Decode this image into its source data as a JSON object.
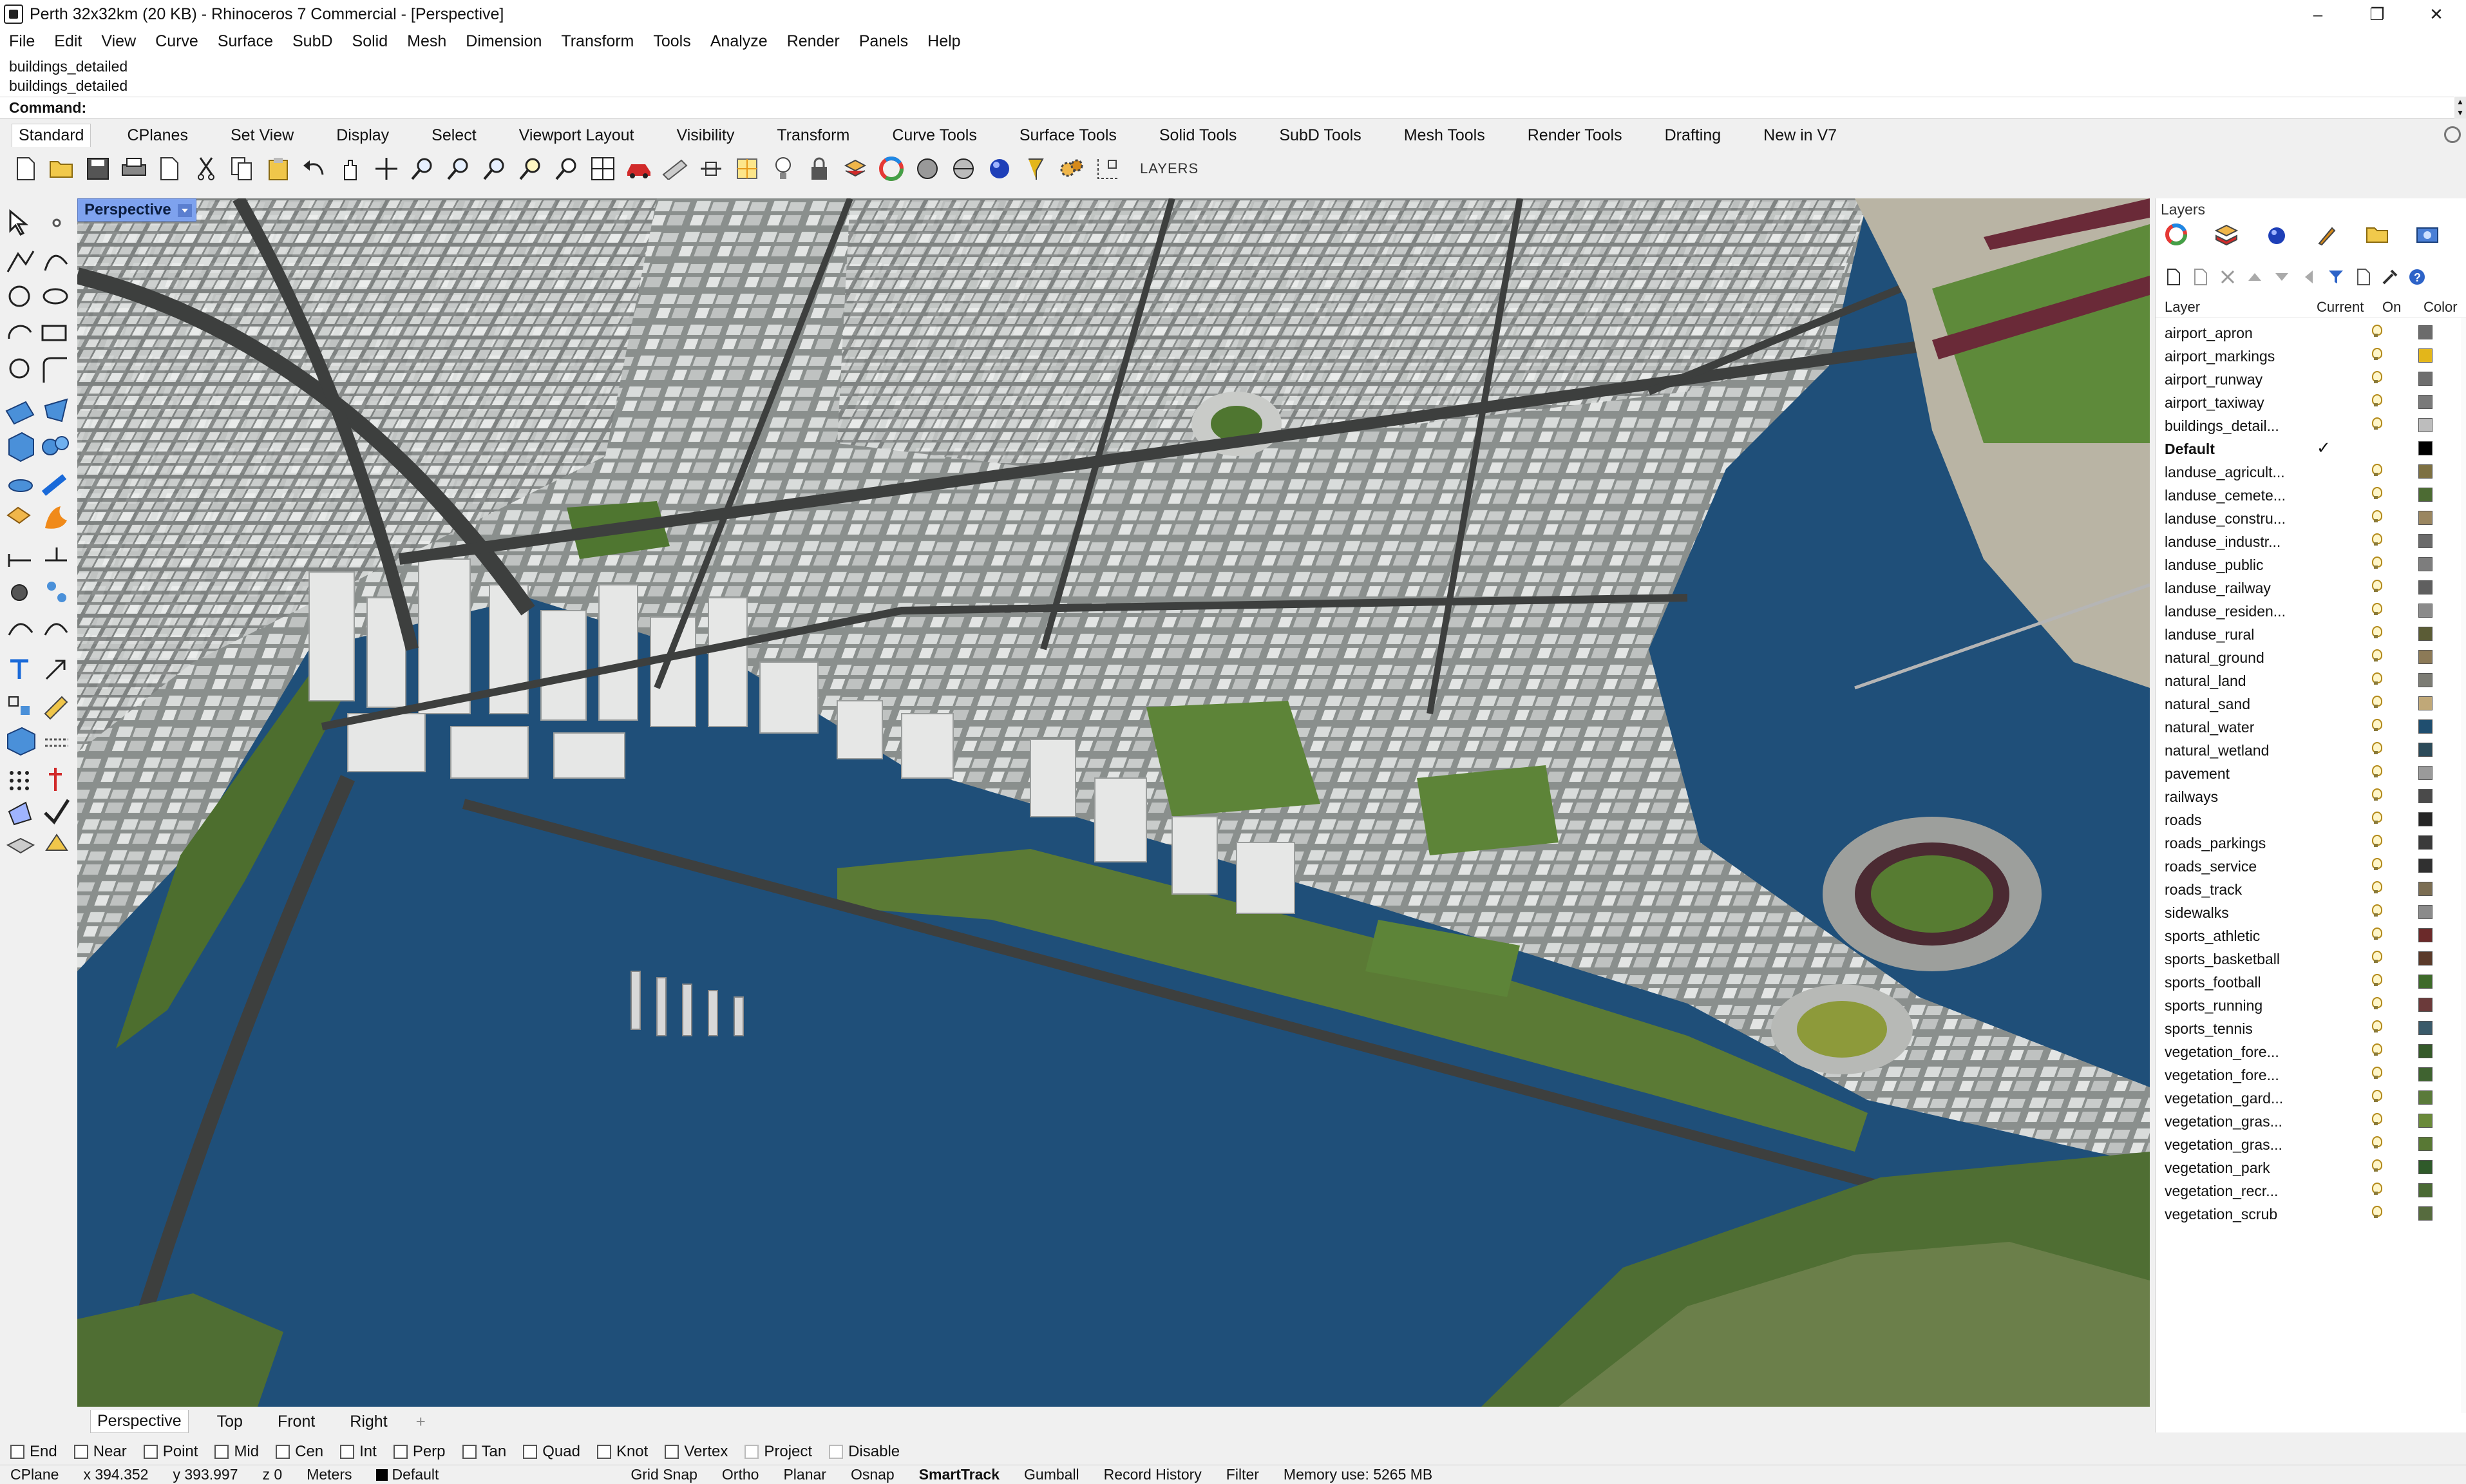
{
  "window": {
    "title": "Perth 32x32km (20 KB) - Rhinoceros 7 Commercial - [Perspective]",
    "minimize": "–",
    "maximize": "❐",
    "close": "✕"
  },
  "menu": [
    "File",
    "Edit",
    "View",
    "Curve",
    "Surface",
    "SubD",
    "Solid",
    "Mesh",
    "Dimension",
    "Transform",
    "Tools",
    "Analyze",
    "Render",
    "Panels",
    "Help"
  ],
  "command_history": [
    "buildings_detailed",
    "buildings_detailed"
  ],
  "command": {
    "label": "Command:",
    "value": ""
  },
  "toolbar_tabs": [
    "Standard",
    "CPlanes",
    "Set View",
    "Display",
    "Select",
    "Viewport Layout",
    "Visibility",
    "Transform",
    "Curve Tools",
    "Surface Tools",
    "Solid Tools",
    "SubD Tools",
    "Mesh Tools",
    "Render Tools",
    "Drafting",
    "New in V7"
  ],
  "toolbar": {
    "icons": [
      "new-icon",
      "open-icon",
      "save-icon",
      "print-icon",
      "import-icon",
      "cut-icon",
      "copy-icon",
      "paste-icon",
      "undo-icon",
      "pan-icon",
      "rotate-view-icon",
      "zoom-icon",
      "zoom-window-icon",
      "zoom-extents-icon",
      "zoom-selected-icon",
      "undo-view-icon",
      "four-viewports-icon",
      "car-icon",
      "ruler-icon",
      "clip-icon",
      "cage-icon",
      "bulb-icon",
      "lock-icon",
      "layer-icon",
      "color-wheel-icon",
      "shade-icon",
      "rendered-icon",
      "sphere-icon",
      "pin-icon",
      "gear-set-icon",
      "grid-snap-icon"
    ],
    "layers_label": "LAYERS"
  },
  "viewport": {
    "label": "Perspective",
    "tabs": [
      "Perspective",
      "Top",
      "Front",
      "Right"
    ],
    "add": "+"
  },
  "osnaps": [
    {
      "label": "End",
      "checked": false
    },
    {
      "label": "Near",
      "checked": false
    },
    {
      "label": "Point",
      "checked": false
    },
    {
      "label": "Mid",
      "checked": false
    },
    {
      "label": "Cen",
      "checked": false
    },
    {
      "label": "Int",
      "checked": false
    },
    {
      "label": "Perp",
      "checked": false
    },
    {
      "label": "Tan",
      "checked": false
    },
    {
      "label": "Quad",
      "checked": false
    },
    {
      "label": "Knot",
      "checked": false
    },
    {
      "label": "Vertex",
      "checked": false
    },
    {
      "label": "Project",
      "checked": false
    },
    {
      "label": "Disable",
      "checked": false
    }
  ],
  "status": {
    "cplane": "CPlane",
    "x": "x 394.352",
    "y": "y 393.997",
    "z": "z 0",
    "units": "Meters",
    "layer": "Default",
    "grid_snap": "Grid Snap",
    "ortho": "Ortho",
    "planar": "Planar",
    "osnap": "Osnap",
    "smarttrack": "SmartTrack",
    "gumball": "Gumball",
    "record_history": "Record History",
    "filter": "Filter",
    "memory": "Memory use: 5265 MB"
  },
  "layers_panel": {
    "title": "Layers",
    "headers": {
      "layer": "Layer",
      "current": "Current",
      "on": "On",
      "color": "Color"
    },
    "current_mark": "✓",
    "rows": [
      {
        "name": "airport_apron",
        "color": "#6b6b6b"
      },
      {
        "name": "airport_markings",
        "color": "#e3b61a"
      },
      {
        "name": "airport_runway",
        "color": "#6e6e6e"
      },
      {
        "name": "airport_taxiway",
        "color": "#7a7a7a"
      },
      {
        "name": "buildings_detail...",
        "color": "#bdbdbd"
      },
      {
        "name": "Default",
        "color": "#000000",
        "current": true,
        "bold": true
      },
      {
        "name": "landuse_agricult...",
        "color": "#7d7042"
      },
      {
        "name": "landuse_cemete...",
        "color": "#4c6b33"
      },
      {
        "name": "landuse_constru...",
        "color": "#9a8660"
      },
      {
        "name": "landuse_industr...",
        "color": "#6a6a6a"
      },
      {
        "name": "landuse_public",
        "color": "#7d7d7d"
      },
      {
        "name": "landuse_railway",
        "color": "#5f5f5f"
      },
      {
        "name": "landuse_residen...",
        "color": "#8a8a8a"
      },
      {
        "name": "landuse_rural",
        "color": "#5b5c36"
      },
      {
        "name": "natural_ground",
        "color": "#8c7a57"
      },
      {
        "name": "natural_land",
        "color": "#7c7c74"
      },
      {
        "name": "natural_sand",
        "color": "#c0a878"
      },
      {
        "name": "natural_water",
        "color": "#1f4e6f"
      },
      {
        "name": "natural_wetland",
        "color": "#2c4b5a"
      },
      {
        "name": "pavement",
        "color": "#9a9a9a"
      },
      {
        "name": "railways",
        "color": "#4a4a4a"
      },
      {
        "name": "roads",
        "color": "#262626"
      },
      {
        "name": "roads_parkings",
        "color": "#3a3a3a"
      },
      {
        "name": "roads_service",
        "color": "#303030"
      },
      {
        "name": "roads_track",
        "color": "#7b6d52"
      },
      {
        "name": "sidewalks",
        "color": "#8b8b8b"
      },
      {
        "name": "sports_athletic",
        "color": "#6b2a2a"
      },
      {
        "name": "sports_basketball",
        "color": "#5a3a2a"
      },
      {
        "name": "sports_football",
        "color": "#3e6a2a"
      },
      {
        "name": "sports_running",
        "color": "#6b3a3a"
      },
      {
        "name": "sports_tennis",
        "color": "#3a5a6a"
      },
      {
        "name": "vegetation_fore...",
        "color": "#355a2a"
      },
      {
        "name": "vegetation_fore...",
        "color": "#3f6330"
      },
      {
        "name": "vegetation_gard...",
        "color": "#5a7a3a"
      },
      {
        "name": "vegetation_gras...",
        "color": "#6a8a3a"
      },
      {
        "name": "vegetation_gras...",
        "color": "#587834"
      },
      {
        "name": "vegetation_park",
        "color": "#2f5a2a"
      },
      {
        "name": "vegetation_recr...",
        "color": "#4a6a34"
      },
      {
        "name": "vegetation_scrub",
        "color": "#566b3e"
      }
    ]
  }
}
